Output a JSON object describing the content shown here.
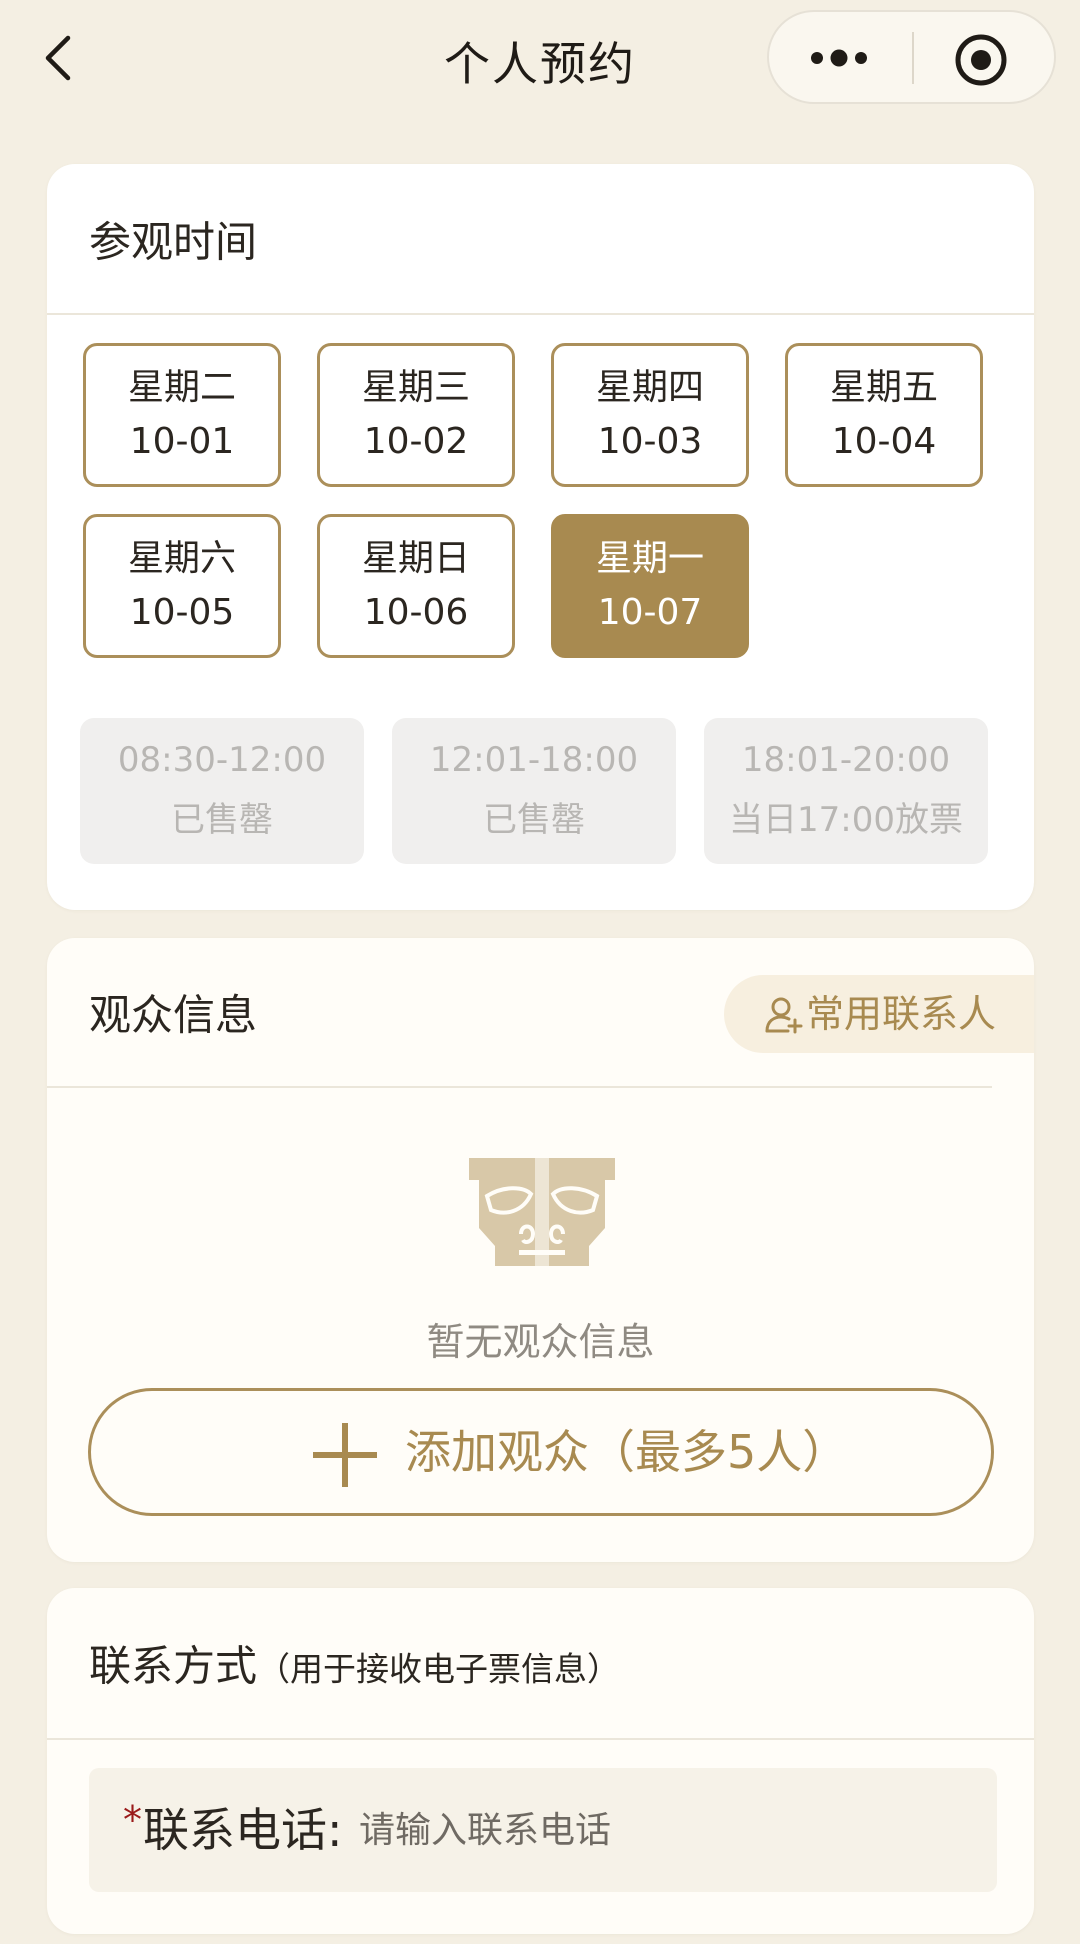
{
  "nav": {
    "title": "个人预约",
    "back_icon": "chevron-left-icon",
    "more_icon": "more-dots-icon",
    "close_icon": "target-icon"
  },
  "visit_time": {
    "title": "参观时间",
    "dates": [
      {
        "weekday": "星期二",
        "date": "10-01",
        "selected": false
      },
      {
        "weekday": "星期三",
        "date": "10-02",
        "selected": false
      },
      {
        "weekday": "星期四",
        "date": "10-03",
        "selected": false
      },
      {
        "weekday": "星期五",
        "date": "10-04",
        "selected": false
      },
      {
        "weekday": "星期六",
        "date": "10-05",
        "selected": false
      },
      {
        "weekday": "星期日",
        "date": "10-06",
        "selected": false
      },
      {
        "weekday": "星期一",
        "date": "10-07",
        "selected": true
      }
    ],
    "slots": [
      {
        "time": "08:30-12:00",
        "state": "已售罄"
      },
      {
        "time": "12:01-18:00",
        "state": "已售罄"
      },
      {
        "time": "18:01-20:00",
        "state": "当日17:00放票"
      }
    ]
  },
  "visitor": {
    "title": "观众信息",
    "contacts_label": "常用联系人",
    "contacts_icon": "add-person-icon",
    "empty_icon": "mask-emblem-icon",
    "empty_text": "暂无观众信息",
    "add_label": "添加观众（最多5人）",
    "add_icon": "plus-icon"
  },
  "contact": {
    "title": "联系方式",
    "subtitle": "（用于接收电子票信息）",
    "required_mark": "*",
    "phone_label": "联系电话:",
    "phone_placeholder": "请输入联系电话",
    "phone_value": ""
  },
  "colors": {
    "accent": "#a88a50",
    "background": "#f4efe3",
    "required": "#9a1a1a",
    "disabled_bg": "#f0efee"
  }
}
